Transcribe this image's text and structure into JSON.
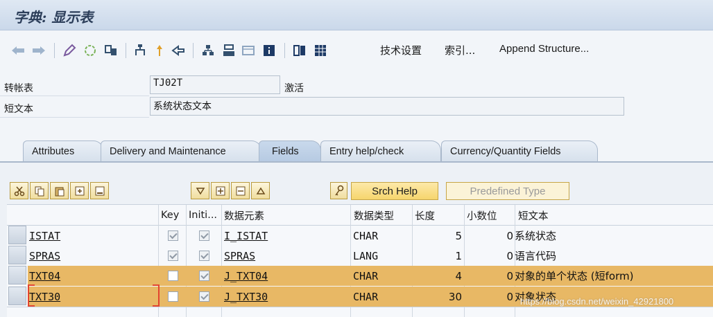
{
  "window": {
    "title": "字典: 显示表"
  },
  "toolbar": {
    "icons": [
      "back-arrow-icon",
      "forward-arrow-icon",
      "edit-pencil-icon",
      "activate-icon",
      "compare-icon",
      "hierarchy-icon",
      "where-used-icon",
      "navigate-icon",
      "object-list-icon",
      "display-structure-icon",
      "frame-icon",
      "info-icon",
      "append-icon",
      "table-icon"
    ],
    "tech_settings": "技术设置",
    "index": "索引...",
    "append_structure": "Append Structure..."
  },
  "header": {
    "table_label": "转帐表",
    "table_value": "TJ02T",
    "status": "激活",
    "short_text_label": "短文本",
    "short_text_value": "系统状态文本"
  },
  "tabs": [
    {
      "label": "Attributes",
      "active": false
    },
    {
      "label": "Delivery and Maintenance",
      "active": false
    },
    {
      "label": "Fields",
      "active": true
    },
    {
      "label": "Entry help/check",
      "active": false
    },
    {
      "label": "Currency/Quantity Fields",
      "active": false
    }
  ],
  "field_toolbar": {
    "srch_help": "Srch Help",
    "predefined_type": "Predefined Type"
  },
  "table": {
    "columns": [
      "Key",
      "Initi...",
      "数据元素",
      "数据类型",
      "长度",
      "小数位",
      "短文本"
    ],
    "rows": [
      {
        "field": "ISTAT",
        "key": true,
        "init": true,
        "data_element": "I_ISTAT",
        "data_type": "CHAR",
        "length": "5",
        "decimals": "0",
        "short_text": "系统状态",
        "selected": false
      },
      {
        "field": "SPRAS",
        "key": true,
        "init": true,
        "data_element": "SPRAS",
        "data_type": "LANG",
        "length": "1",
        "decimals": "0",
        "short_text": "语言代码",
        "selected": false
      },
      {
        "field": "TXT04",
        "key": false,
        "init": true,
        "data_element": "J_TXT04",
        "data_type": "CHAR",
        "length": "4",
        "decimals": "0",
        "short_text": "对象的单个状态 (短form)",
        "selected": true
      },
      {
        "field": "TXT30",
        "key": false,
        "init": true,
        "data_element": "J_TXT30",
        "data_type": "CHAR",
        "length": "30",
        "decimals": "0",
        "short_text": "对象状态",
        "selected": true
      }
    ]
  },
  "watermark": "https://blog.csdn.net/weixin_42921800",
  "colors": {
    "selected_row": "#e8b865",
    "titlebar": "#cad8ea",
    "accent_button": "#f6d56d"
  }
}
